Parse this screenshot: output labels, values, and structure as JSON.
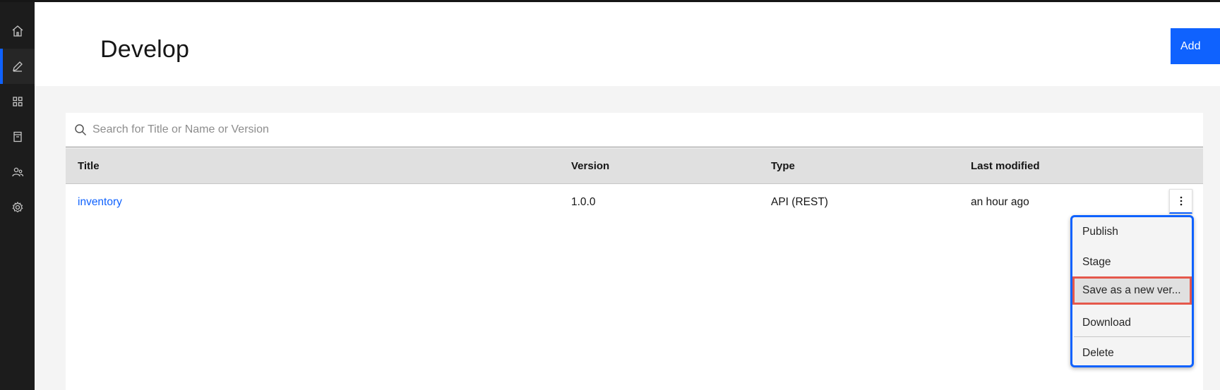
{
  "page": {
    "title": "Develop",
    "add_label": "Add"
  },
  "search": {
    "placeholder": "Search for Title or Name or Version",
    "value": ""
  },
  "table": {
    "columns": [
      "Title",
      "Version",
      "Type",
      "Last modified"
    ],
    "rows": [
      {
        "title": "inventory",
        "version": "1.0.0",
        "type": "API (REST)",
        "last_modified": "an hour ago"
      }
    ]
  },
  "menu": {
    "items": [
      "Publish",
      "Stage",
      "Save as a new ver...",
      "Download",
      "Delete"
    ],
    "highlighted_index": 2
  },
  "nav": {
    "items": [
      "home-icon",
      "edit-icon",
      "apps-icon",
      "catalog-icon",
      "users-icon",
      "settings-icon"
    ],
    "active_index": 1
  },
  "colors": {
    "accent": "#0f62fe",
    "highlight_border": "#e5584b",
    "sidenav_bg": "#1c1c1c"
  }
}
